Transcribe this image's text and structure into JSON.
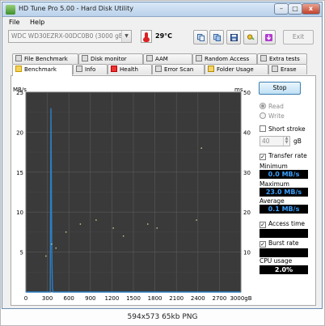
{
  "window": {
    "title": "HD Tune Pro 5.00 - Hard Disk Utility",
    "min_glyph": "–",
    "max_glyph": "□",
    "close_glyph": "x"
  },
  "menu": {
    "file": "File",
    "help": "Help"
  },
  "toolbar": {
    "drive": "WDC WD30EZRX-00DC0B0 (3000 gB)",
    "temperature": "29°C",
    "exit": "Exit",
    "buttons": [
      "copy-icon",
      "copy-screen-icon",
      "save-icon",
      "options-icon",
      "download-icon"
    ]
  },
  "tabs": {
    "row1": [
      "File Benchmark",
      "Disk monitor",
      "AAM",
      "Random Access",
      "Extra tests"
    ],
    "row2": [
      "Benchmark",
      "Info",
      "Health",
      "Error Scan",
      "Folder Usage",
      "Erase"
    ],
    "active": "Benchmark"
  },
  "controls": {
    "stop": "Stop",
    "read": "Read",
    "write": "Write",
    "short_stroke": "Short stroke",
    "short_stroke_value": "40",
    "short_stroke_unit": "gB",
    "transfer_rate": "Transfer rate",
    "minimum_label": "Minimum",
    "minimum_value": "0.0 MB/s",
    "maximum_label": "Maximum",
    "maximum_value": "23.0 MB/s",
    "average_label": "Average",
    "average_value": "0.1 MB/s",
    "access_time": "Access time",
    "burst_rate": "Burst rate",
    "cpu_label": "CPU usage",
    "cpu_value": "2.0%",
    "check_mark": "✓"
  },
  "chart_data": {
    "type": "line",
    "background": "#3a3a3a",
    "grid": true,
    "series_color": "#2b7fc6",
    "y_unit": "MB/s",
    "y2_unit": "ms",
    "xlim": [
      0,
      3000
    ],
    "ylim": [
      0,
      25
    ],
    "y2lim": [
      0,
      50
    ],
    "x_ticks": [
      "0",
      "300",
      "600",
      "900",
      "1200",
      "1500",
      "1800",
      "2100",
      "2400",
      "2700",
      "3000gB"
    ],
    "y_ticks": [
      "25",
      "20",
      "15",
      "10",
      "5"
    ],
    "y2_ticks": [
      "50",
      "40",
      "30",
      "20",
      "10"
    ],
    "series": [
      {
        "x": [
          0,
          340,
          350,
          360,
          370,
          380,
          395,
          410,
          3000
        ],
        "y": [
          0,
          0,
          23.0,
          6.0,
          0.5,
          0,
          0,
          0,
          0
        ]
      }
    ],
    "access_points": [
      {
        "x": 280,
        "y": 9
      },
      {
        "x": 360,
        "y": 12
      },
      {
        "x": 420,
        "y": 11
      },
      {
        "x": 560,
        "y": 15
      },
      {
        "x": 760,
        "y": 17
      },
      {
        "x": 980,
        "y": 18
      },
      {
        "x": 1220,
        "y": 16
      },
      {
        "x": 1360,
        "y": 14
      },
      {
        "x": 1700,
        "y": 17
      },
      {
        "x": 1830,
        "y": 16
      },
      {
        "x": 2380,
        "y": 18
      },
      {
        "x": 2450,
        "y": 36
      }
    ]
  },
  "footer": {
    "caption": "594x573 65kb PNG"
  }
}
